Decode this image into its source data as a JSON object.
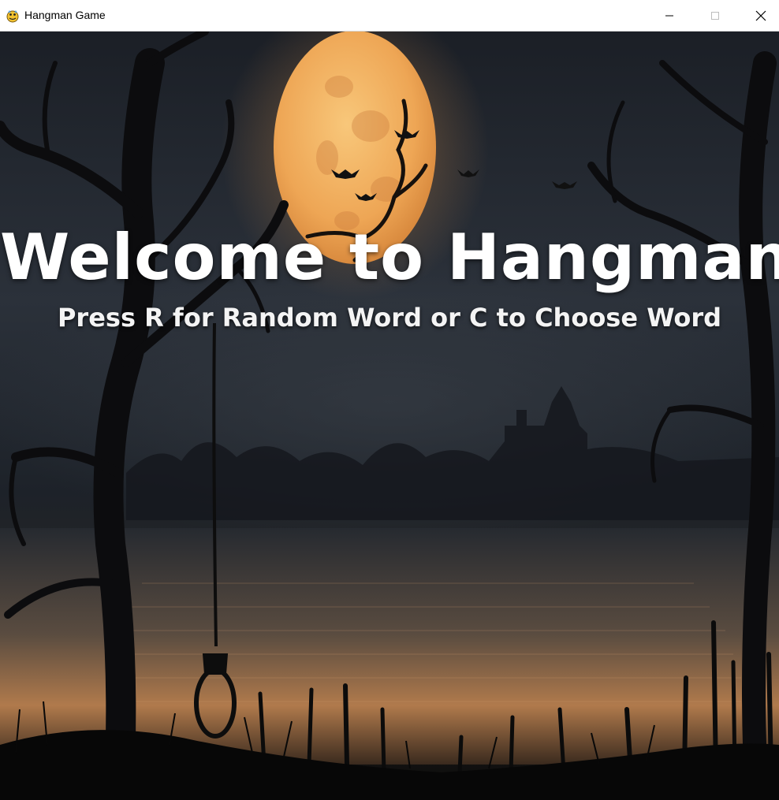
{
  "window": {
    "title": "Hangman Game",
    "icon": "pygame-snake-icon",
    "controls": [
      "minimize-icon",
      "maximize-icon",
      "close-icon"
    ]
  },
  "welcome": {
    "title": "Welcome to Hangman",
    "instructions": "Press R for Random Word or C to Choose Word"
  },
  "colors": {
    "moon": "#f3b45a",
    "sky": "#2a2f38",
    "water_glow": "#c88a55",
    "text": "#ffffff"
  }
}
